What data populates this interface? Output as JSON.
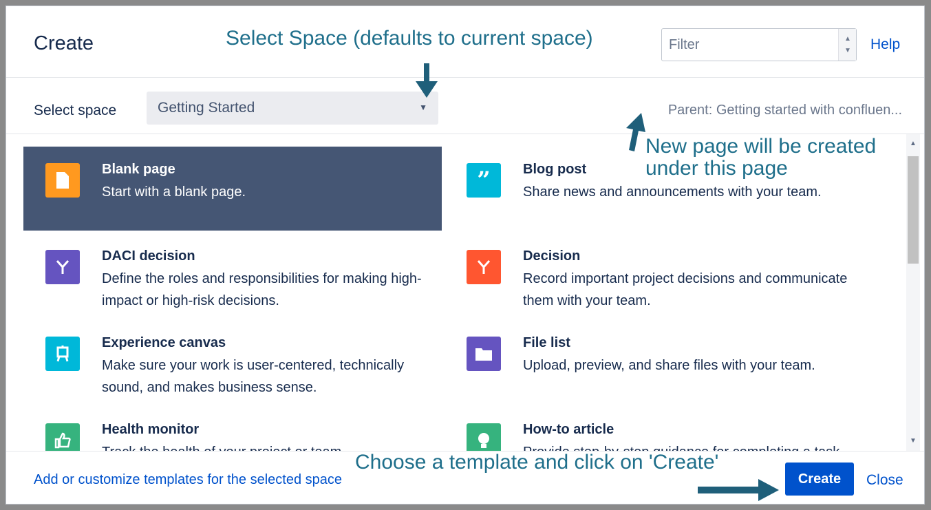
{
  "dialog": {
    "title": "Create",
    "filter_placeholder": "Filter",
    "help_label": "Help",
    "select_space_label": "Select space",
    "selected_space": "Getting Started",
    "parent_text": "Parent: Getting started with confluen...",
    "templates": [
      {
        "name": "Blank page",
        "desc": "Start with a blank page.",
        "icon": "blank-page-icon",
        "color": "#ff991f",
        "selected": true
      },
      {
        "name": "Blog post",
        "desc": "Share news and announcements with your team.",
        "icon": "quote-icon",
        "color": "#00b8d9"
      },
      {
        "name": "DACI decision",
        "desc": "Define the roles and responsibilities for making high-impact or high-risk decisions.",
        "icon": "fork-icon",
        "color": "#6554c0"
      },
      {
        "name": "Decision",
        "desc": "Record important project decisions and communicate them with your team.",
        "icon": "fork-icon",
        "color": "#ff5630"
      },
      {
        "name": "Experience canvas",
        "desc": "Make sure your work is user-centered, technically sound, and makes business sense.",
        "icon": "easel-icon",
        "color": "#00b8d9"
      },
      {
        "name": "File list",
        "desc": "Upload, preview, and share files with your team.",
        "icon": "folder-icon",
        "color": "#6554c0"
      },
      {
        "name": "Health monitor",
        "desc": "Track the health of your project or team.",
        "icon": "thumbs-up-icon",
        "color": "#36b37e"
      },
      {
        "name": "How-to article",
        "desc": "Provide step-by-step guidance for completing a task.",
        "icon": "lightbulb-icon",
        "color": "#36b37e"
      }
    ],
    "footer_link": "Add or customize templates for the selected space",
    "create_label": "Create",
    "close_label": "Close"
  },
  "annotations": {
    "select_space": "Select Space (defaults to current space)",
    "new_page_line1": "New page will be created",
    "new_page_line2": "under this page",
    "choose_template": "Choose a template and click on 'Create'"
  },
  "colors": {
    "selected_bg": "#455674",
    "primary": "#0052cc",
    "annotation": "#1f6f8b"
  }
}
